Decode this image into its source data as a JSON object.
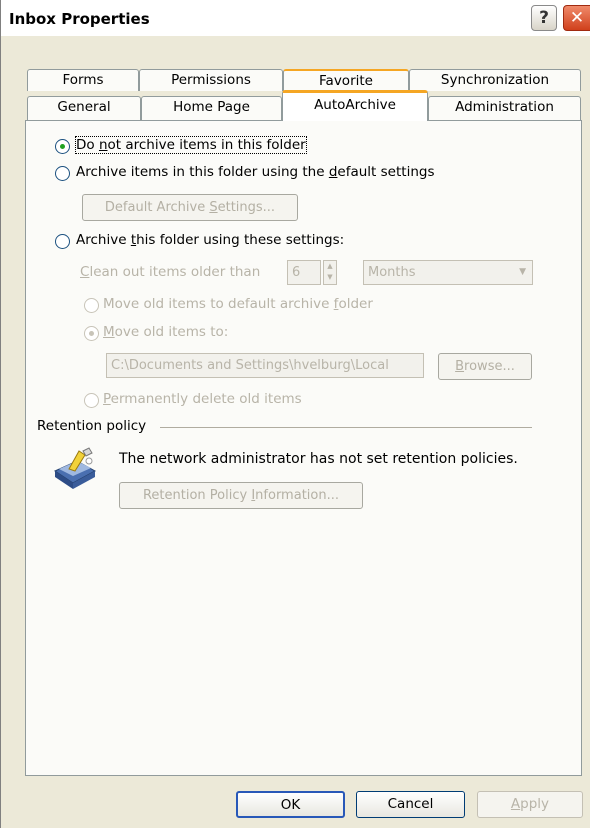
{
  "window": {
    "title": "Inbox Properties"
  },
  "tabs": {
    "upper": [
      "Forms",
      "Permissions",
      "Favorite",
      "Synchronization"
    ],
    "lower": [
      "General",
      "Home Page",
      "AutoArchive",
      "Administration"
    ],
    "active": "AutoArchive"
  },
  "autoarchive": {
    "option_no_archive": {
      "pre": "Do ",
      "key": "n",
      "post": "ot archive items in this folder"
    },
    "option_default": {
      "pre": "Archive items in this folder using the ",
      "key": "d",
      "post": "efault settings"
    },
    "default_settings_button": {
      "pre": "Default Archive ",
      "key": "S",
      "post": "ettings..."
    },
    "option_custom": {
      "pre": "Archive ",
      "key": "t",
      "post": "his folder using these settings:"
    },
    "clean_out_label": {
      "pre": "",
      "key": "C",
      "post": "lean out items older than"
    },
    "clean_out_value": "6",
    "clean_out_unit": "Months",
    "move_default": {
      "pre": "Move old items to default archive ",
      "key": "f",
      "post": "older"
    },
    "move_to": {
      "pre": "",
      "key": "M",
      "post": "ove old items to:"
    },
    "archive_path": "C:\\Documents and Settings\\hvelburg\\Local",
    "browse_button": {
      "pre": "",
      "key": "B",
      "post": "rowse..."
    },
    "delete_option": {
      "pre": "",
      "key": "P",
      "post": "ermanently delete old items"
    }
  },
  "retention": {
    "group_label": "Retention policy",
    "message": "The network administrator has not set retention policies.",
    "info_button": {
      "pre": "Retention Policy ",
      "key": "I",
      "post": "nformation..."
    }
  },
  "footer": {
    "ok": "OK",
    "cancel": "Cancel",
    "apply": {
      "pre": "",
      "key": "A",
      "post": "pply"
    }
  },
  "colors": {
    "tab_highlight": "#f5a623",
    "radio_checked": "#21a121",
    "dialog_bg": "#ece9d8"
  }
}
